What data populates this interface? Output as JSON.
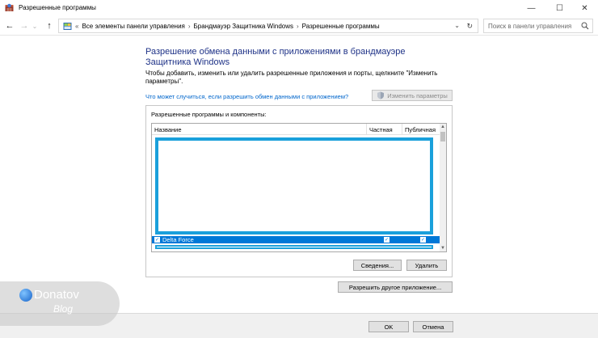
{
  "window": {
    "title": "Разрешенные программы",
    "minimize_glyph": "—",
    "maximize_glyph": "☐",
    "close_glyph": "✕"
  },
  "nav": {
    "back_glyph": "←",
    "forward_glyph": "→",
    "recent_glyph": "⌄",
    "up_glyph": "↑",
    "breadcrumb_root_glyph": "«",
    "breadcrumb": [
      "Все элементы панели управления",
      "Брандмауэр Защитника Windows",
      "Разрешенные программы"
    ],
    "breadcrumb_sep": "›",
    "dropdown_glyph": "⌄",
    "refresh_glyph": "↻"
  },
  "search": {
    "placeholder": "Поиск в панели управления"
  },
  "main": {
    "heading": "Разрешение обмена данными с приложениями в брандмауэре Защитника Windows",
    "description": "Чтобы добавить, изменить или удалить разрешенные приложения и порты, щелкните \"Изменить параметры\".",
    "risk_link": "Что может случиться, если разрешить обмен данными с приложением?",
    "change_settings_label": "Изменить параметры",
    "group_label": "Разрешенные программы и компоненты:",
    "columns": {
      "name": "Название",
      "private": "Частная",
      "public": "Публичная"
    },
    "rows": [
      {
        "name": "Delta Force",
        "enabled": true,
        "private": true,
        "public": true
      }
    ],
    "checkmark_glyph": "✓",
    "details_button": "Сведения...",
    "remove_button": "Удалить",
    "allow_another_button": "Разрешить другое приложение..."
  },
  "footer": {
    "ok_label": "OK",
    "cancel_label": "Отмена"
  },
  "watermark": {
    "name": "Donatov",
    "sub": "Blog"
  },
  "colors": {
    "heading": "#1e3287",
    "link": "#0066cc",
    "selection": "#0078d7",
    "highlight": "#1aa0db"
  }
}
